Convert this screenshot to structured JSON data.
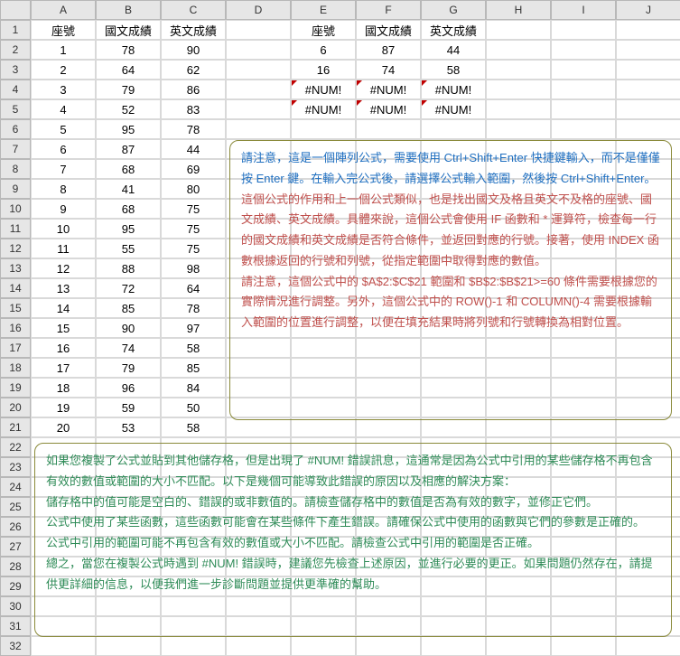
{
  "columns": [
    "A",
    "B",
    "C",
    "D",
    "E",
    "F",
    "G",
    "H",
    "I",
    "J"
  ],
  "rowCount": 32,
  "headers1": {
    "A": "座號",
    "B": "國文成績",
    "C": "英文成績"
  },
  "headers2": {
    "E": "座號",
    "F": "國文成績",
    "G": "英文成績"
  },
  "leftData": [
    {
      "A": "1",
      "B": "78",
      "C": "90"
    },
    {
      "A": "2",
      "B": "64",
      "C": "62"
    },
    {
      "A": "3",
      "B": "79",
      "C": "86"
    },
    {
      "A": "4",
      "B": "52",
      "C": "83"
    },
    {
      "A": "5",
      "B": "95",
      "C": "78"
    },
    {
      "A": "6",
      "B": "87",
      "C": "44"
    },
    {
      "A": "7",
      "B": "68",
      "C": "69"
    },
    {
      "A": "8",
      "B": "41",
      "C": "80"
    },
    {
      "A": "9",
      "B": "68",
      "C": "75"
    },
    {
      "A": "10",
      "B": "95",
      "C": "75"
    },
    {
      "A": "11",
      "B": "55",
      "C": "75"
    },
    {
      "A": "12",
      "B": "88",
      "C": "98"
    },
    {
      "A": "13",
      "B": "72",
      "C": "64"
    },
    {
      "A": "14",
      "B": "85",
      "C": "78"
    },
    {
      "A": "15",
      "B": "90",
      "C": "97"
    },
    {
      "A": "16",
      "B": "74",
      "C": "58"
    },
    {
      "A": "17",
      "B": "79",
      "C": "85"
    },
    {
      "A": "18",
      "B": "96",
      "C": "84"
    },
    {
      "A": "19",
      "B": "59",
      "C": "50"
    },
    {
      "A": "20",
      "B": "53",
      "C": "58"
    }
  ],
  "rightData": [
    {
      "E": "6",
      "F": "87",
      "G": "44",
      "err": false
    },
    {
      "E": "16",
      "F": "74",
      "G": "58",
      "err": false
    },
    {
      "E": "#NUM!",
      "F": "#NUM!",
      "G": "#NUM!",
      "err": true
    },
    {
      "E": "#NUM!",
      "F": "#NUM!",
      "G": "#NUM!",
      "err": true
    }
  ],
  "box1": {
    "blue": [
      "請注意，這是一個陣列公式，需要使用 Ctrl+Shift+Enter 快捷鍵輸入，而不是僅僅按 Enter 鍵。在輸入完公式後，請選擇公式輸入範圍，然後按 Ctrl+Shift+Enter。"
    ],
    "red": [
      "這個公式的作用和上一個公式類似，也是找出國文及格且英文不及格的座號、國文成績、英文成績。具體來說，這個公式會使用 IF 函數和 * 運算符，檢查每一行的國文成績和英文成績是否符合條件，並返回對應的行號。接著，使用 INDEX 函數根據返回的行號和列號，從指定範圍中取得對應的數值。",
      "請注意，這個公式中的 $A$2:$C$21 範圍和 $B$2:$B$21>=60 條件需要根據您的實際情況進行調整。另外，這個公式中的 ROW()-1 和 COLUMN()-4 需要根據輸入範圍的位置進行調整，以便在填充結果時將列號和行號轉換為相對位置。"
    ]
  },
  "box2": [
    "如果您複製了公式並貼到其他儲存格，但是出現了 #NUM! 錯誤訊息，這通常是因為公式中引用的某些儲存格不再包含有效的數值或範圍的大小不匹配。以下是幾個可能導致此錯誤的原因以及相應的解決方案：",
    "儲存格中的值可能是空白的、錯誤的或非數值的。請檢查儲存格中的數值是否為有效的數字，並修正它們。",
    "公式中使用了某些函數，這些函數可能會在某些條件下產生錯誤。請確保公式中使用的函數與它們的參數是正確的。",
    "公式中引用的範圍可能不再包含有效的數值或大小不匹配。請檢查公式中引用的範圍是否正確。",
    "總之，當您在複製公式時遇到 #NUM! 錯誤時，建議您先檢查上述原因，並進行必要的更正。如果問題仍然存在，請提供更詳細的信息，以便我們進一步診斷問題並提供更準確的幫助。"
  ]
}
